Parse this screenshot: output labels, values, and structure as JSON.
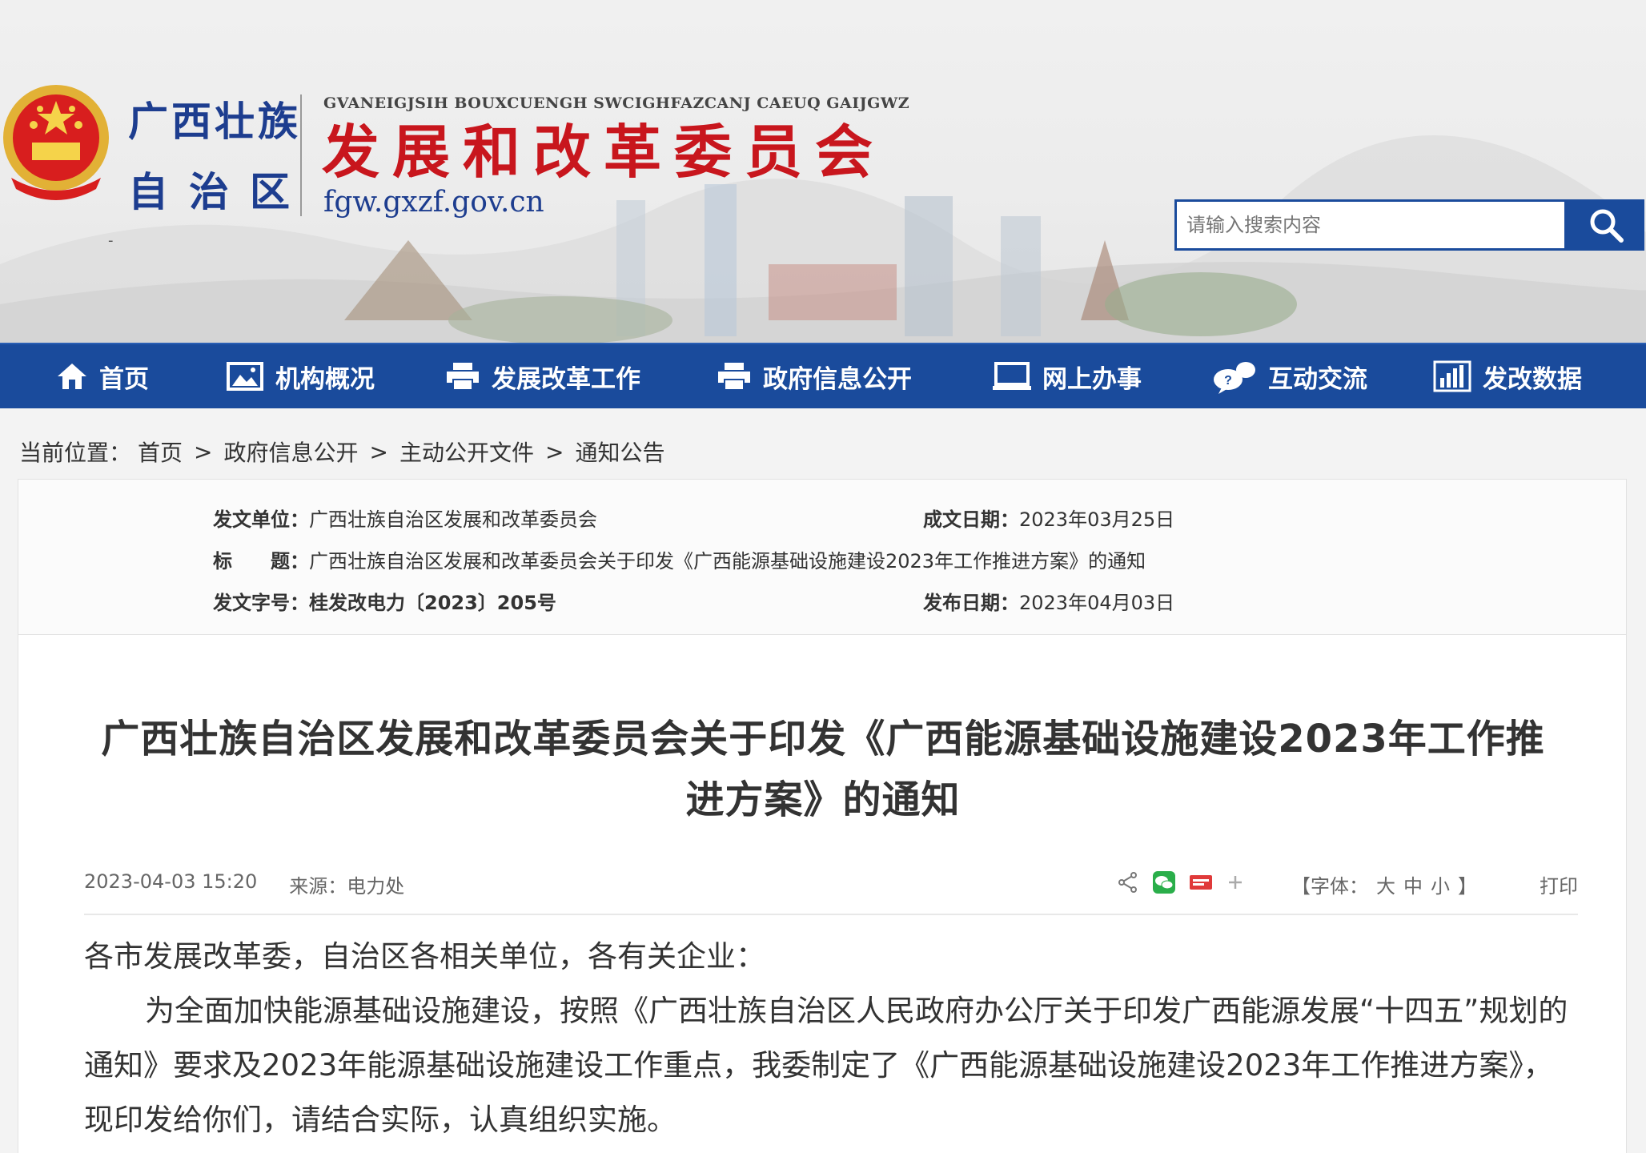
{
  "header": {
    "region_line1": "广西壮族",
    "region_line2": "自治区",
    "org_pinyin": "GVANEIGJSIH BOUXCUENGH SWCIGHFAZCANJ CAEUQ GAIJGWZ",
    "org_name": "发展和改革委员会",
    "org_domain": "fgw.gxzf.gov.cn",
    "stray_mark": "-",
    "search_placeholder": "请输入搜索内容"
  },
  "nav": {
    "items": [
      {
        "label": "首页",
        "icon": "home-icon"
      },
      {
        "label": "机构概况",
        "icon": "picture-icon"
      },
      {
        "label": "发展改革工作",
        "icon": "printer-icon"
      },
      {
        "label": "政府信息公开",
        "icon": "printer-icon"
      },
      {
        "label": "网上办事",
        "icon": "monitor-icon"
      },
      {
        "label": "互动交流",
        "icon": "chat-icon"
      },
      {
        "label": "发改数据",
        "icon": "bar-chart-icon"
      }
    ]
  },
  "breadcrumb": {
    "prefix": "当前位置：",
    "items": [
      "首页",
      "政府信息公开",
      "主动公开文件",
      "通知公告"
    ],
    "separator": ">"
  },
  "meta": {
    "issuer_label": "发文单位：",
    "issuer_value": "广西壮族自治区发展和改革委员会",
    "created_label": "成文日期：",
    "created_value": "2023年03月25日",
    "title_label_1": "标",
    "title_label_2": "题：",
    "title_value": "广西壮族自治区发展和改革委员会关于印发《广西能源基础设施建设2023年工作推进方案》的通知",
    "docno_label": "发文字号：",
    "docno_value": "桂发改电力〔2023〕205号",
    "published_label": "发布日期：",
    "published_value": "2023年04月03日"
  },
  "article": {
    "title_line1": "广西壮族自治区发展和改革委员会关于印发《广西能源基础设施建设2023年工作推",
    "title_line2": "进方案》的通知",
    "datetime": "2023-04-03 15:20",
    "source": "来源：电力处",
    "font_prefix": "【字体：",
    "font_large": "大",
    "font_medium": "中",
    "font_small": "小",
    "font_suffix": "】",
    "print": "打印",
    "salutation": "各市发展改革委，自治区各相关单位，各有关企业：",
    "paragraph1": "为全面加快能源基础设施建设，按照《广西壮族自治区人民政府办公厅关于印发广西能源发展“十四五”规划的通知》要求及2023年能源基础设施建设工作重点，我委制定了《广西能源基础设施建设2023年工作推进方案》，现印发给你们，请结合实际，认真组织实施。"
  },
  "colors": {
    "nav_bg": "#1a4b9c",
    "org_red": "#c8161d",
    "region_blue": "#1d3d8f"
  }
}
